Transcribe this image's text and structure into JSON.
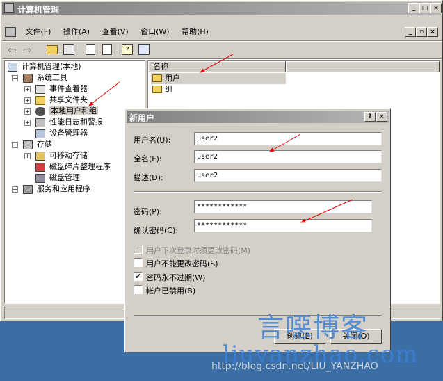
{
  "window": {
    "title": "计算机管理"
  },
  "menu": [
    "文件(F)",
    "操作(A)",
    "查看(V)",
    "窗口(W)",
    "帮助(H)"
  ],
  "tree": {
    "root": "计算机管理(本地)",
    "system_tools": "系统工具",
    "event_viewer": "事件查看器",
    "shared_folders": "共享文件夹",
    "local_users": "本地用户和组",
    "perf_logs": "性能日志和警报",
    "device_manager": "设备管理器",
    "storage": "存储",
    "removable": "可移动存储",
    "defrag": "磁盘碎片整理程序",
    "disk_mgmt": "磁盘管理",
    "services": "服务和应用程序"
  },
  "list": {
    "header": "名称",
    "items": [
      "用户",
      "组"
    ]
  },
  "dialog": {
    "title": "新用户",
    "username_label": "用户名(U):",
    "username_value": "user2",
    "fullname_label": "全名(F):",
    "fullname_value": "user2",
    "desc_label": "描述(D):",
    "desc_value": "user2",
    "password_label": "密码(P):",
    "password_value": "************",
    "confirm_label": "确认密码(C):",
    "confirm_value": "************",
    "opt_change_next": "用户下次登录时须更改密码(M)",
    "opt_cannot_change": "用户不能更改密码(S)",
    "opt_never_expires": "密码永不过期(W)",
    "opt_disabled": "帐户已禁用(B)",
    "opt_change_next_checked": false,
    "opt_cannot_change_checked": false,
    "opt_never_expires_checked": true,
    "opt_disabled_checked": false,
    "create_button": "创建(E)",
    "close_button": "关闭(O)",
    "help_button": "?",
    "close_x": "×"
  },
  "watermark": {
    "line1": "言噁博客",
    "line2": "liuyanzhao.com",
    "line3": "http://blog.csdn.net/LIU_YANZHAO"
  },
  "colors": {
    "titlebar": "#808080",
    "dialog_titlebar": "#808080",
    "desktop": "#3a6ea5",
    "arrow": "#e00000",
    "watermark": "#3b7fd4"
  }
}
